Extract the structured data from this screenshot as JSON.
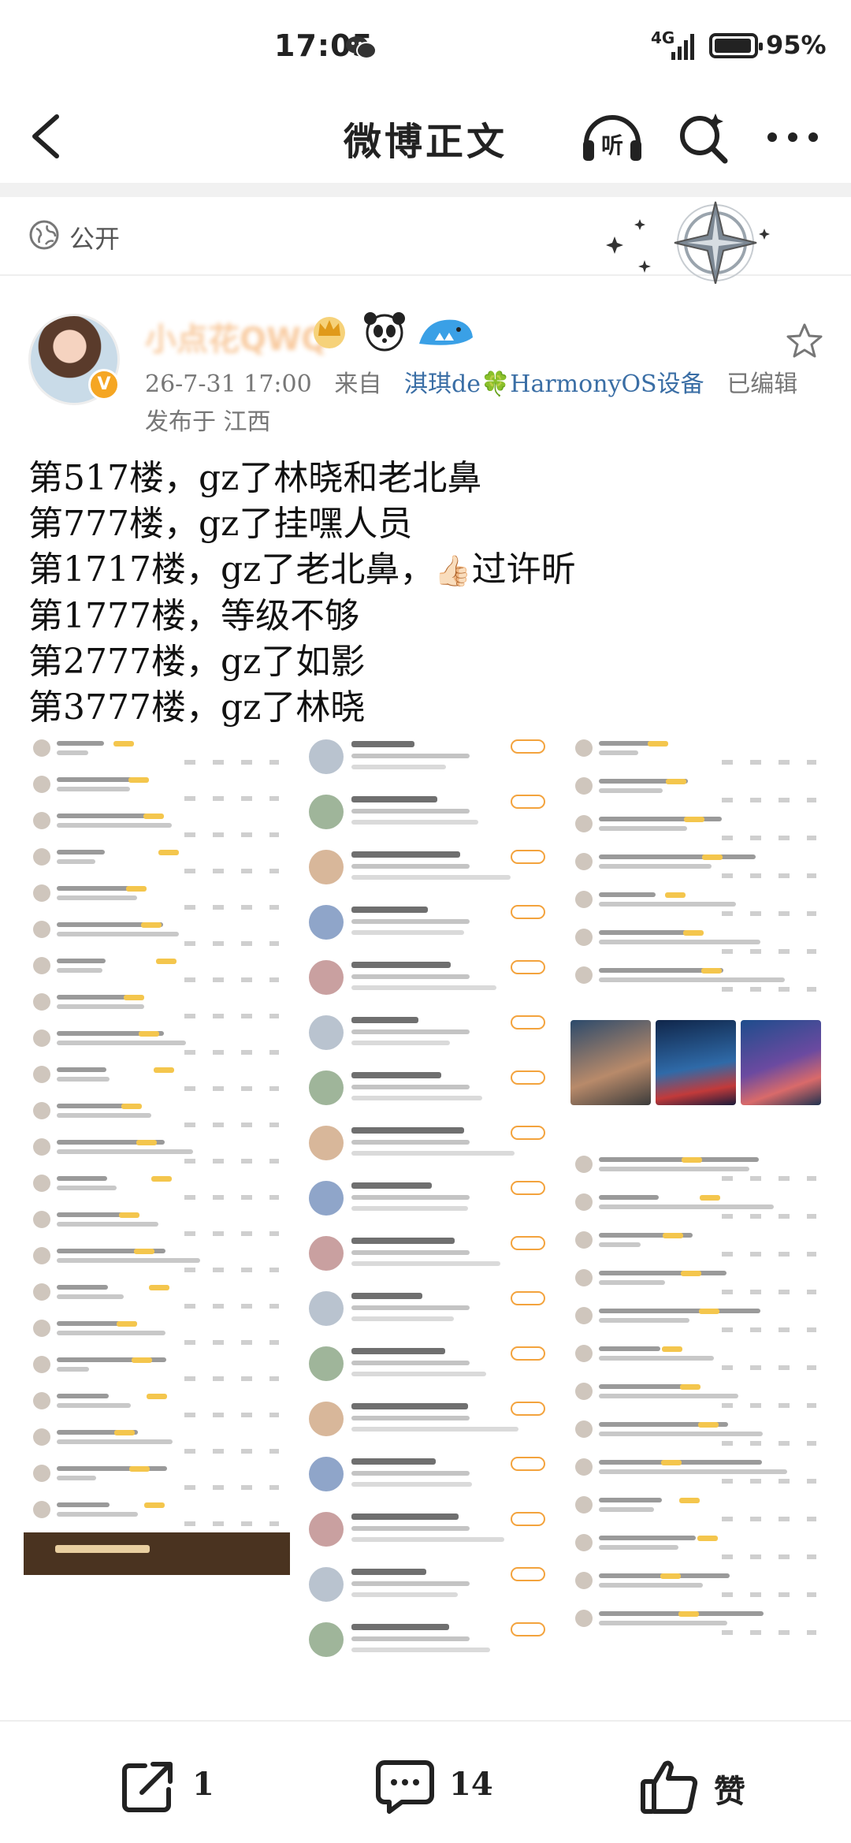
{
  "status_bar": {
    "time": "17:05",
    "network": "4G",
    "battery_percent": "95%",
    "battery_level": 0.95
  },
  "nav": {
    "title": "微博正文",
    "listen_label": "听"
  },
  "visibility": {
    "label": "公开"
  },
  "author": {
    "name": "小点花QWQ",
    "verified_mark": "V",
    "medals": [
      "crown-medal",
      "panda-emoji",
      "shark-emoji"
    ],
    "timestamp": "26-7-31 17:00",
    "source_prefix": "来自",
    "device": "淇琪de🍀HarmonyOS设备",
    "edited": "已编辑",
    "location": "发布于 江西"
  },
  "post": {
    "lines": [
      "第517楼，gz了林晓和老北鼻",
      "第777楼，gz了挂嘿人员",
      "第1717楼，gz了老北鼻，",
      "第1777楼，等级不够",
      "第2777楼，gz了如影",
      "第3777楼，gz了林晓"
    ],
    "line3_emoji": "👍🏻",
    "line3_suffix": "过许昕"
  },
  "actions": {
    "repost_count": "1",
    "comment_count": "14",
    "like_label": "赞"
  },
  "colors": {
    "accent_orange": "#f08c2e",
    "link_blue": "#3a6ea5",
    "verify_gold": "#f5a623"
  }
}
